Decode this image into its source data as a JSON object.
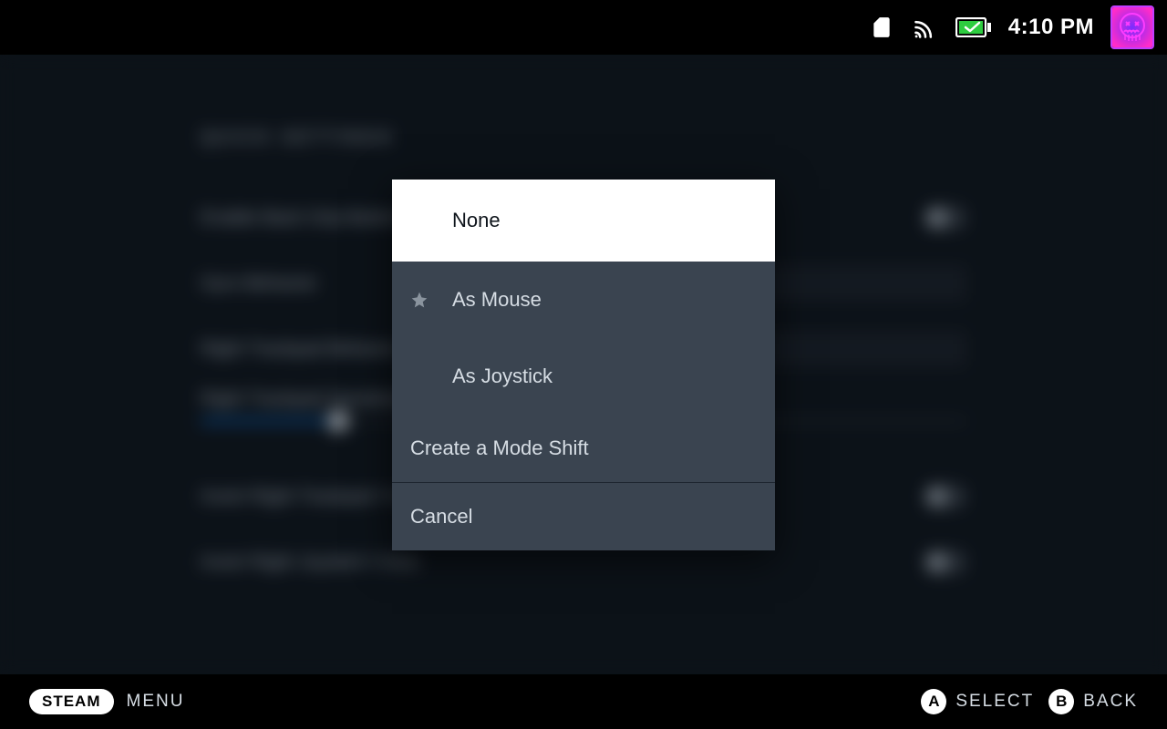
{
  "statusbar": {
    "clock": "4:10 PM"
  },
  "background": {
    "section_title": "QUICK SETTINGS",
    "rows": [
      "Enable Back Grip Buttons",
      "Gyro Behavior",
      "Right Trackpad Behavior",
      "Right Trackpad Sensitivity",
      "Invert Right Trackpad Y-Axis",
      "Invert Right Joystick Y-Axis"
    ]
  },
  "modal": {
    "options": [
      {
        "label": "None",
        "selected": true,
        "star": false
      },
      {
        "label": "As Mouse",
        "selected": false,
        "star": true
      },
      {
        "label": "As Joystick",
        "selected": false,
        "star": false
      }
    ],
    "create": "Create a Mode Shift",
    "cancel": "Cancel"
  },
  "bottombar": {
    "steam": "STEAM",
    "menu": "MENU",
    "hints": [
      {
        "button": "A",
        "label": "SELECT"
      },
      {
        "button": "B",
        "label": "BACK"
      }
    ]
  }
}
